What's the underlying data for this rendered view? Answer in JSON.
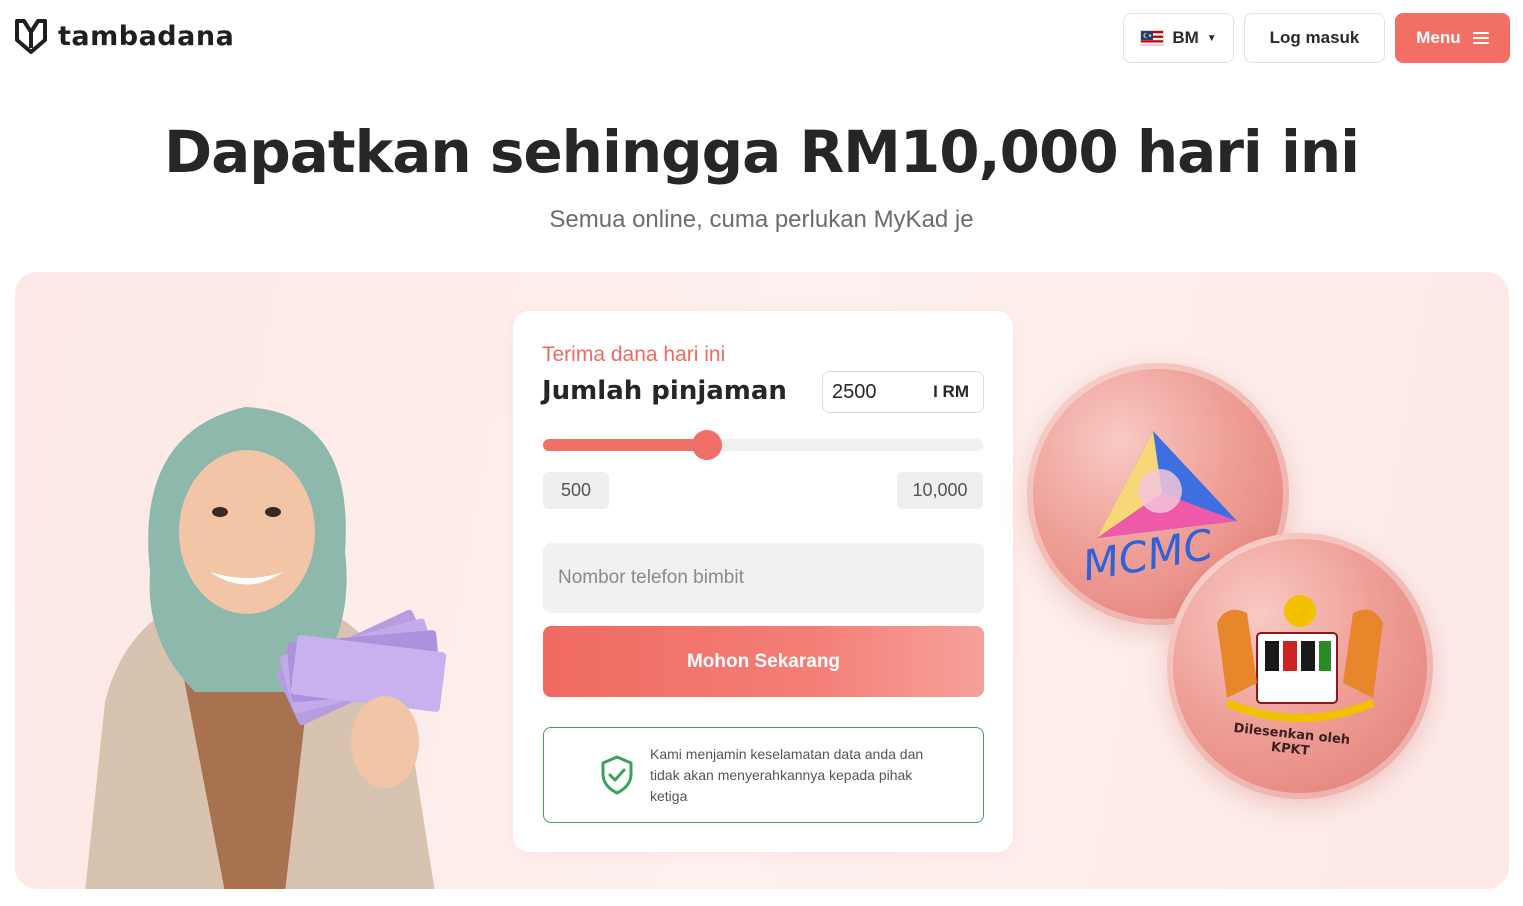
{
  "header": {
    "brand": "tambadana",
    "language_label": "BM",
    "login_label": "Log masuk",
    "menu_label": "Menu"
  },
  "hero": {
    "title": "Dapatkan sehingga RM10,000 hari ini",
    "subtitle": "Semua online, cuma perlukan MyKad je"
  },
  "loan_form": {
    "eyebrow": "Terima dana hari ini",
    "title": "Jumlah pinjaman",
    "amount_value": "2500",
    "currency": "I RM",
    "slider_min": "500",
    "slider_max": "10,000",
    "slider_value": 2500,
    "phone_placeholder": "Nombor telefon bimbit",
    "apply_label": "Mohon Sekarang",
    "security_text": "Kami menjamin keselamatan data anda dan tidak akan menyerahkannya kepada pihak ketiga"
  },
  "badges": {
    "mcmc_text": "MCMC",
    "kpkt_text": "Dilesenkan oleh KPKT"
  },
  "colors": {
    "accent": "#f26f66",
    "panel_bg": "#fde8e5",
    "secure_green": "#3aa35a"
  }
}
